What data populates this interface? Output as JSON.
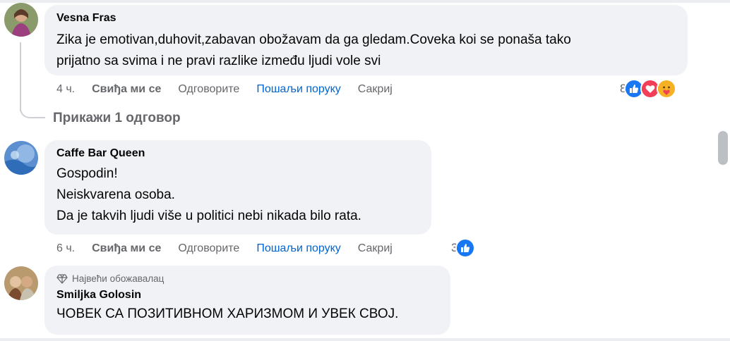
{
  "comments": [
    {
      "author": "Vesna Fras",
      "text": "Zika je emotivan,duhovit,zabavan obožavam da ga gledam.Coveka koi se ponaša tako\nprijatno sa svima i ne pravi razlike između ljudi vole svi",
      "time": "4 ч.",
      "like": "Свиђа ми се",
      "reply": "Одговорите",
      "message": "Пошаљи поруку",
      "hide": "Сакриј",
      "reaction_count": "8",
      "reactions": [
        "like-icon",
        "love-icon",
        "care-icon"
      ]
    },
    {
      "author": "Caffe Bar Queen",
      "text": "Gospodin!\nNeiskvarena osoba.\nDa je takvih ljudi više u politici nebi nikada bilo rata.",
      "time": "6 ч.",
      "like": "Свиђа ми се",
      "reply": "Одговорите",
      "message": "Пошаљи поруку",
      "hide": "Сакриј",
      "reaction_count": "3",
      "reactions": [
        "like-icon"
      ]
    },
    {
      "badge": "Највећи обожавалац",
      "author": "Smiljka Golosin",
      "text": "ЧОВЕК СА ПОЗИТИВНОМ ХАРИЗМОМ И УВЕК СВОЈ."
    }
  ],
  "show_replies": "Прикажи 1 одговор",
  "colors": {
    "bubble": "#f0f2f5",
    "link_blue": "#0064d1",
    "muted": "#65676b",
    "like_blue": "#1877f2",
    "love_red": "#f33e58"
  }
}
